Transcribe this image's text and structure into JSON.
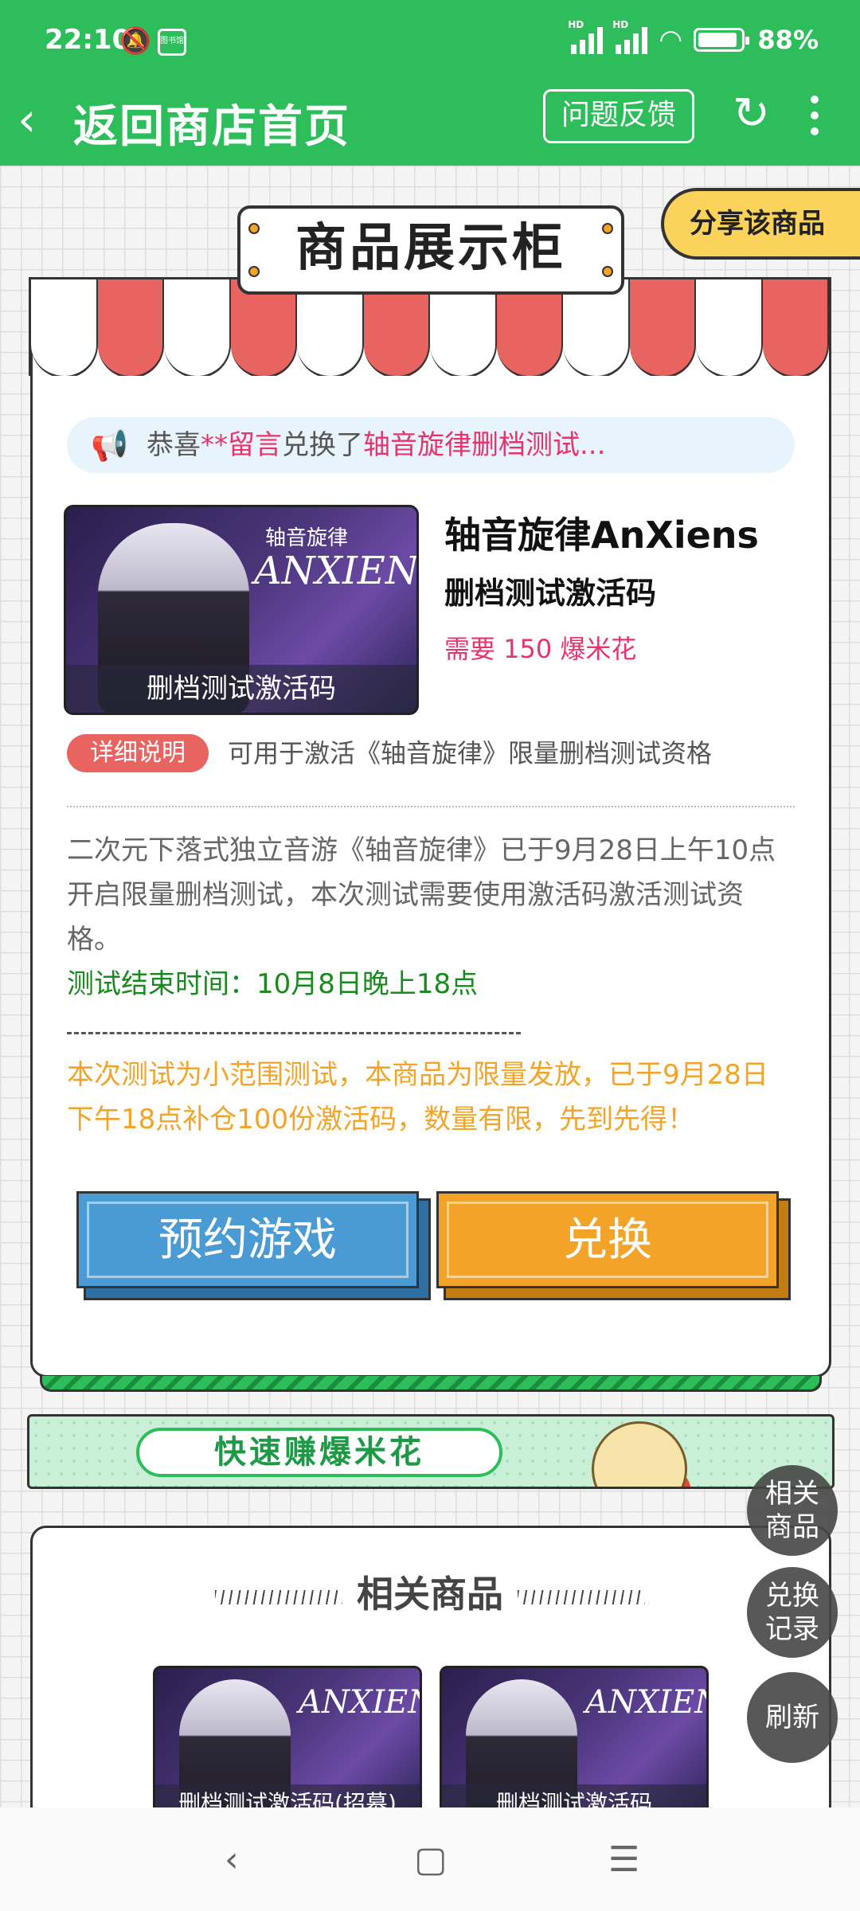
{
  "status_bar": {
    "time": "22:10",
    "battery": "88%",
    "app_icon_text": "图书馆"
  },
  "app_bar": {
    "back_icon": "chevron-left-icon",
    "title": "返回商店首页",
    "feedback": "问题反馈",
    "refresh_icon": "refresh-icon",
    "more_icon": "more-vertical-icon"
  },
  "share_button": "分享该商品",
  "showcase": {
    "sign": "商品展示柜",
    "notice": {
      "prefix": "恭喜",
      "user": "**留言",
      "mid": "兑换了",
      "item": "轴音旋律删档测试..."
    },
    "product": {
      "thumb_logo_cn": "轴音旋律",
      "thumb_logo_en": "ANXIENS",
      "thumb_caption": "删档测试激活码",
      "name": "轴音旋律AnXiens",
      "subtitle": "删档测试激活码",
      "price": "需要 150 爆米花"
    },
    "detail_tag": "详细说明",
    "detail_desc": "可用于激活《轴音旋律》限量删档测试资格",
    "description": "二次元下落式独立音游《轴音旋律》已于9月28日上午10点开启限量删档测试，本次测试需要使用激活码激活测试资格。",
    "end_time": "测试结束时间：10月8日晚上18点",
    "notice2": "本次测试为小范围测试，本商品为限量发放，已于9月28日下午18点补仓100份激活码，数量有限，先到先得！",
    "reserve_button": "预约游戏",
    "redeem_button": "兑换"
  },
  "banner": {
    "text": "快速赚爆米花"
  },
  "floating": {
    "related": "相关\n商品",
    "records": "兑换\n记录",
    "refresh": "刷新"
  },
  "related": {
    "title": "相关商品",
    "items": [
      {
        "logo": "ANXIENS",
        "caption": "删档测试激活码(招募)"
      },
      {
        "logo": "ANXIENS",
        "caption": "删档测试激活码"
      }
    ]
  },
  "nav_bar": {
    "back": "‹",
    "home": "▢",
    "menu": "☰"
  },
  "colors": {
    "brand_green": "#2dbd5a",
    "accent_red": "#e86460",
    "price_pink": "#e5356d",
    "orange": "#f3a428",
    "blue": "#4a9ad4"
  }
}
